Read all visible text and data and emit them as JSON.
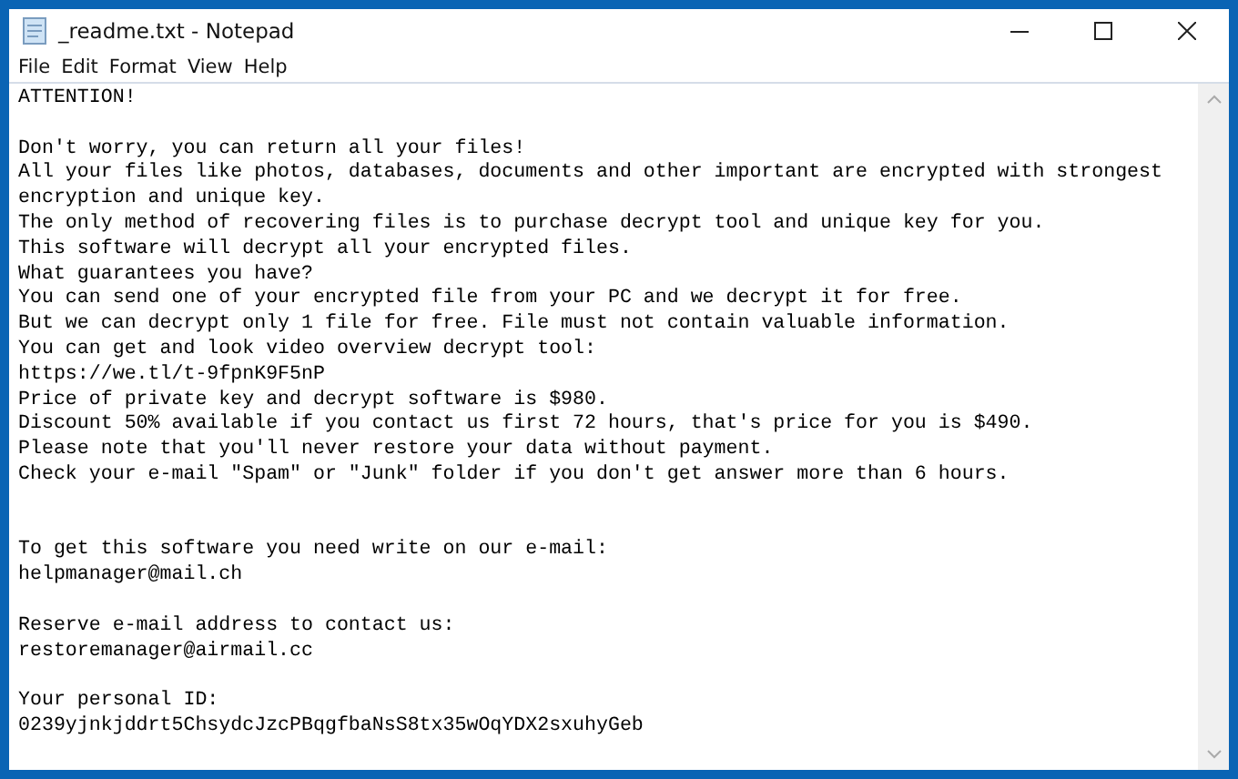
{
  "window": {
    "title": "_readme.txt - Notepad"
  },
  "menu": [
    "File",
    "Edit",
    "Format",
    "View",
    "Help"
  ],
  "editor": {
    "text": "ATTENTION!\n\nDon't worry, you can return all your files!\nAll your files like photos, databases, documents and other important are encrypted with strongest\nencryption and unique key.\nThe only method of recovering files is to purchase decrypt tool and unique key for you.\nThis software will decrypt all your encrypted files.\nWhat guarantees you have?\nYou can send one of your encrypted file from your PC and we decrypt it for free.\nBut we can decrypt only 1 file for free. File must not contain valuable information.\nYou can get and look video overview decrypt tool:\nhttps://we.tl/t-9fpnK9F5nP\nPrice of private key and decrypt software is $980.\nDiscount 50% available if you contact us first 72 hours, that's price for you is $490.\nPlease note that you'll never restore your data without payment.\nCheck your e-mail \"Spam\" or \"Junk\" folder if you don't get answer more than 6 hours.\n\n\nTo get this software you need write on our e-mail:\nhelpmanager@mail.ch\n\nReserve e-mail address to contact us:\nrestoremanager@airmail.cc\n\nYour personal ID:\n0239yjnkjddrt5ChsydcJzcPBqgfbaNsS8tx35wOqYDX2sxuhyGeb"
  }
}
